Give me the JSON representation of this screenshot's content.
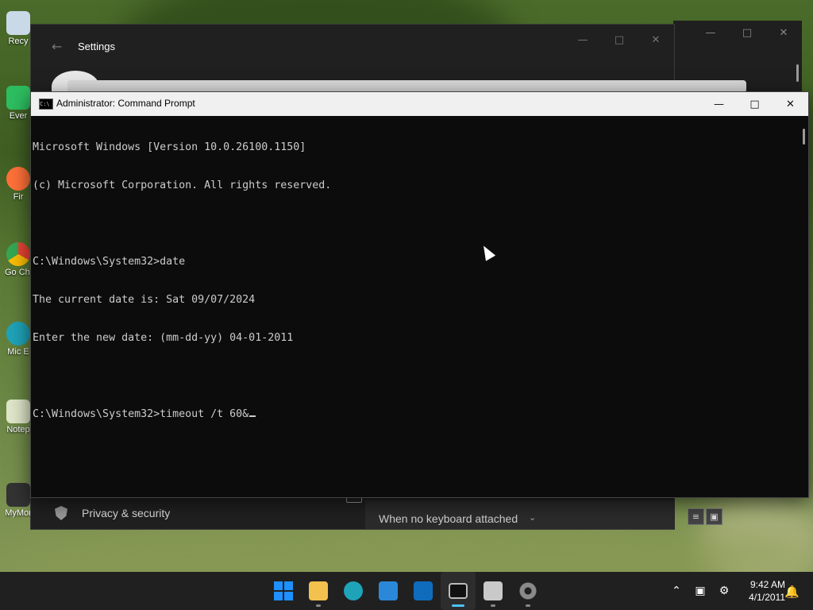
{
  "desktop": {
    "icons": [
      {
        "label": "Recy"
      },
      {
        "label": "Ever"
      },
      {
        "label": "Fir"
      },
      {
        "label": "Go Chr"
      },
      {
        "label": "Mic E"
      },
      {
        "label": "Notep"
      },
      {
        "label": "MyMor"
      }
    ]
  },
  "settings_window": {
    "title": "Settings",
    "nav_item": "Privacy & security",
    "keyboard_option": "When no keyboard attached"
  },
  "cmd_window": {
    "title": "Administrator: Command Prompt",
    "icon": "cmd-icon",
    "lines": [
      "Microsoft Windows [Version 10.0.26100.1150]",
      "(c) Microsoft Corporation. All rights reserved.",
      "",
      "C:\\Windows\\System32>date",
      "The current date is: Sat 09/07/2024",
      "Enter the new date: (mm-dd-yy) 04-01-2011",
      "",
      "C:\\Windows\\System32>timeout /t 60&"
    ]
  },
  "taskbar": {
    "apps": [
      {
        "name": "start",
        "icon": "windows-logo-icon",
        "color": "#1e90ff"
      },
      {
        "name": "file-explorer",
        "icon": "folder-icon",
        "color": "#f2c14e"
      },
      {
        "name": "edge",
        "icon": "edge-icon",
        "color": "#1fa3b8"
      },
      {
        "name": "store",
        "icon": "store-icon",
        "color": "#2b88d8"
      },
      {
        "name": "outlook",
        "icon": "outlook-icon",
        "color": "#0f6cbd"
      },
      {
        "name": "terminal",
        "icon": "terminal-icon",
        "color": "#3a3a3a"
      },
      {
        "name": "installer",
        "icon": "installer-icon",
        "color": "#c9c9c9"
      },
      {
        "name": "settings",
        "icon": "gear-icon",
        "color": "#8a8a8a"
      }
    ],
    "clock": {
      "time": "9:42 AM",
      "date": "4/1/2011"
    }
  }
}
